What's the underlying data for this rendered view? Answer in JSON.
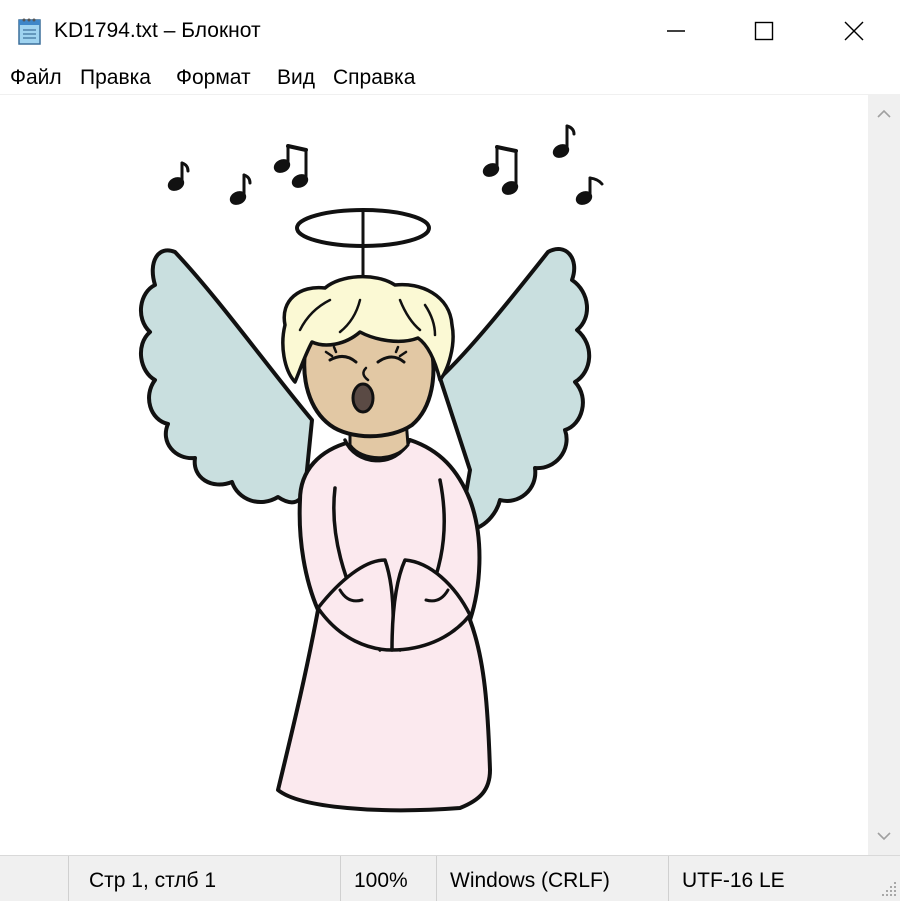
{
  "window": {
    "title": "KD1794.txt – Блокнот",
    "controls": [
      "minimize-icon",
      "maximize-icon",
      "close-icon"
    ]
  },
  "menu": {
    "items": [
      {
        "label": "Файл"
      },
      {
        "label": "Правка"
      },
      {
        "label": "Формат"
      },
      {
        "label": "Вид"
      },
      {
        "label": "Справка"
      }
    ]
  },
  "content": {
    "image_icon": "singing-angel-illustration",
    "colors": {
      "wings": "#c9dfdf",
      "robe": "#fbe9ee",
      "skin": "#e2c8a4",
      "hair": "#fbf9d4",
      "outline": "#111111"
    }
  },
  "status": {
    "position": "Стр 1, стлб 1",
    "zoom": "100%",
    "line_ending": "Windows (CRLF)",
    "encoding": "UTF-16 LE"
  }
}
